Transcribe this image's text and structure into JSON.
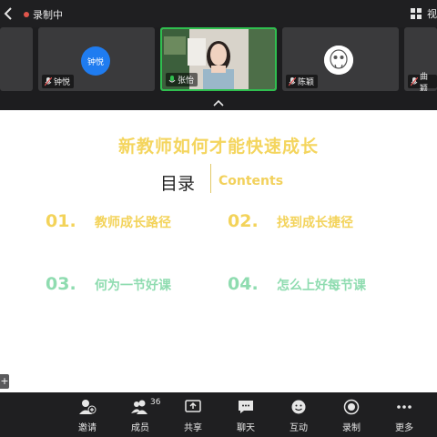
{
  "top_bar": {
    "recording_label": "录制中",
    "view_label": "视"
  },
  "participants": [
    {
      "name": "钟悦",
      "avatar_text": "钟悦"
    },
    {
      "name": "张怡"
    },
    {
      "name": "陈颖"
    },
    {
      "name": "曲颖"
    }
  ],
  "slide": {
    "title": "新教师如何才能快速成长",
    "heading": "目录",
    "heading_en": "Contents",
    "items": [
      {
        "num": "01.",
        "label": "教师成长路径"
      },
      {
        "num": "02.",
        "label": "找到成长捷径"
      },
      {
        "num": "03.",
        "label": "何为一节好课"
      },
      {
        "num": "04.",
        "label": "怎么上好每节课"
      }
    ],
    "colors": {
      "title": "#f4d55e",
      "yellow": "#f3d35a",
      "green": "#8fdcb0"
    }
  },
  "side_button": "+",
  "toolbar": {
    "invite": "邀请",
    "members": "成员",
    "member_count": "36",
    "share": "共享",
    "chat": "聊天",
    "interact": "互动",
    "record": "录制",
    "more": "更多"
  }
}
